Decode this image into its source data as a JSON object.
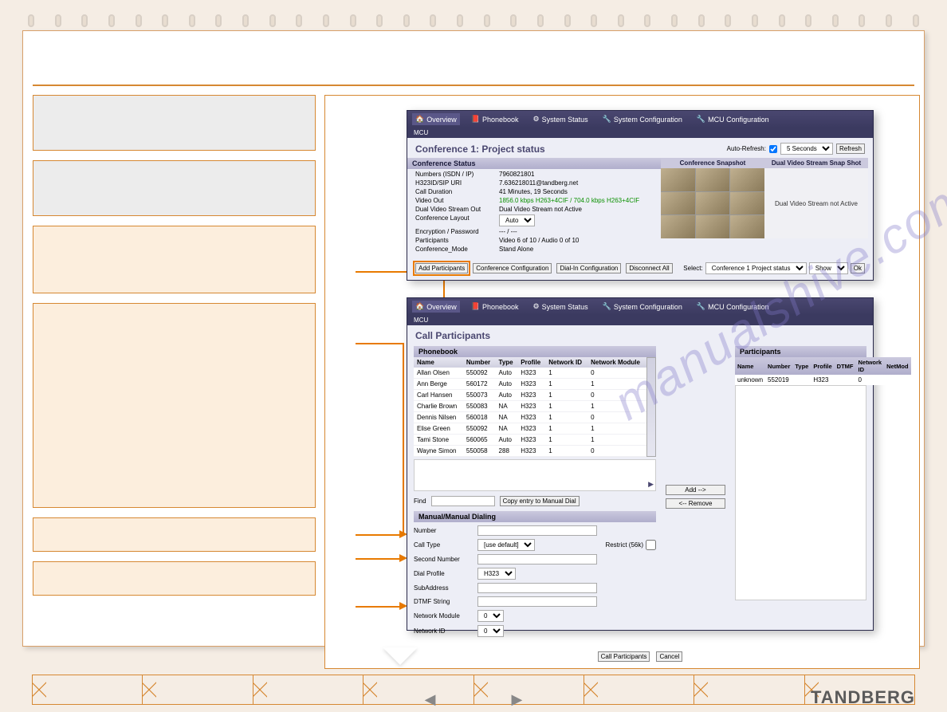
{
  "brand": "TANDBERG",
  "watermark": "manualshive.com",
  "tabs": {
    "overview": "Overview",
    "phonebook": "Phonebook",
    "system_status": "System Status",
    "system_config": "System Configuration",
    "mcu_config": "MCU Configuration"
  },
  "mcu_label": "MCU",
  "panel1": {
    "title": "Conference 1: Project status",
    "auto_refresh": "Auto-Refresh:",
    "seconds": "5 Seconds",
    "refresh": "Refresh",
    "heading": "Conference Status",
    "snapshot_head": "Conference Snapshot",
    "dvs_head": "Dual Video Stream Snap Shot",
    "dvs_text": "Dual Video Stream not Active",
    "kv": [
      {
        "k": "Numbers (ISDN / IP)",
        "v": "7960821801"
      },
      {
        "k": "H323ID/SIP URI",
        "v": "7.636218011@tandberg.net"
      },
      {
        "k": "Call Duration",
        "v": "41 Minutes, 19 Seconds"
      },
      {
        "k": "Video Out",
        "v": "1856.0 kbps H263+4CIF / 704.0 kbps H263+4CIF",
        "green": true
      },
      {
        "k": "Dual Video Stream Out",
        "v": "Dual Video Stream not Active"
      },
      {
        "k": "Conference Layout",
        "v": "Auto",
        "select": true
      },
      {
        "k": "Encryption / Password",
        "v": "--- / ---"
      },
      {
        "k": "Participants",
        "v": "Video 6 of 10 / Audio 0 of 10"
      },
      {
        "k": "Conference_Mode",
        "v": "Stand Alone"
      }
    ],
    "buttons": {
      "add": "Add Participants",
      "conf_cfg": "Conference Configuration",
      "dial_cfg": "Dial-In Configuration",
      "disc_all": "Disconnect All",
      "select_label": "Select:",
      "select_val": "Conference 1 Project status",
      "show": "Show",
      "ok": "Ok"
    }
  },
  "panel2": {
    "title": "Call Participants",
    "phonebook_head": "Phonebook",
    "columns": [
      "Name",
      "Number",
      "Type",
      "Profile",
      "Network ID",
      "Network Module"
    ],
    "rows": [
      {
        "name": "Allan Olsen",
        "num": "550092",
        "type": "Auto",
        "profile": "H323",
        "nid": "1",
        "nmod": "0"
      },
      {
        "name": "Ann Berge",
        "num": "560172",
        "type": "Auto",
        "profile": "H323",
        "nid": "1",
        "nmod": "1"
      },
      {
        "name": "Carl Hansen",
        "num": "550073",
        "type": "Auto",
        "profile": "H323",
        "nid": "1",
        "nmod": "0"
      },
      {
        "name": "Charlie Brown",
        "num": "550083",
        "type": "NA",
        "profile": "H323",
        "nid": "1",
        "nmod": "1"
      },
      {
        "name": "Dennis Nilsen",
        "num": "560018",
        "type": "NA",
        "profile": "H323",
        "nid": "1",
        "nmod": "0"
      },
      {
        "name": "Elise Green",
        "num": "550092",
        "type": "NA",
        "profile": "H323",
        "nid": "1",
        "nmod": "1"
      },
      {
        "name": "Tami Stone",
        "num": "560065",
        "type": "Auto",
        "profile": "H323",
        "nid": "1",
        "nmod": "1"
      },
      {
        "name": "Wayne Simon",
        "num": "550058",
        "type": "288",
        "profile": "H323",
        "nid": "1",
        "nmod": "0"
      }
    ],
    "find_label": "Find",
    "copy_btn": "Copy entry to Manual Dial",
    "manual_head": "Manual/Manual Dialing",
    "manual": {
      "number": "Number",
      "call_type": "Call Type",
      "call_type_val": "[use default]",
      "restrict": "Restrict (56k)",
      "second_number": "Second Number",
      "dial_profile": "Dial Profile",
      "dial_profile_val": "H323",
      "subaddress": "SubAddress",
      "dtmf": "DTMF String",
      "net_module": "Network Module",
      "net_module_val": "0",
      "net_id": "Network ID",
      "net_id_val": "0"
    },
    "participants_head": "Participants",
    "p_columns": [
      "Name",
      "Number",
      "Type",
      "Profile",
      "DTMF",
      "Network ID",
      "NetMod"
    ],
    "p_rows": [
      {
        "name": "unknown",
        "num": "552019",
        "type": "",
        "profile": "H323",
        "dtmf": "",
        "nid": "0",
        "nmod": ""
      }
    ],
    "add_btn": "Add -->",
    "remove_btn": "<-- Remove",
    "call_btn": "Call Participants",
    "cancel_btn": "Cancel"
  }
}
